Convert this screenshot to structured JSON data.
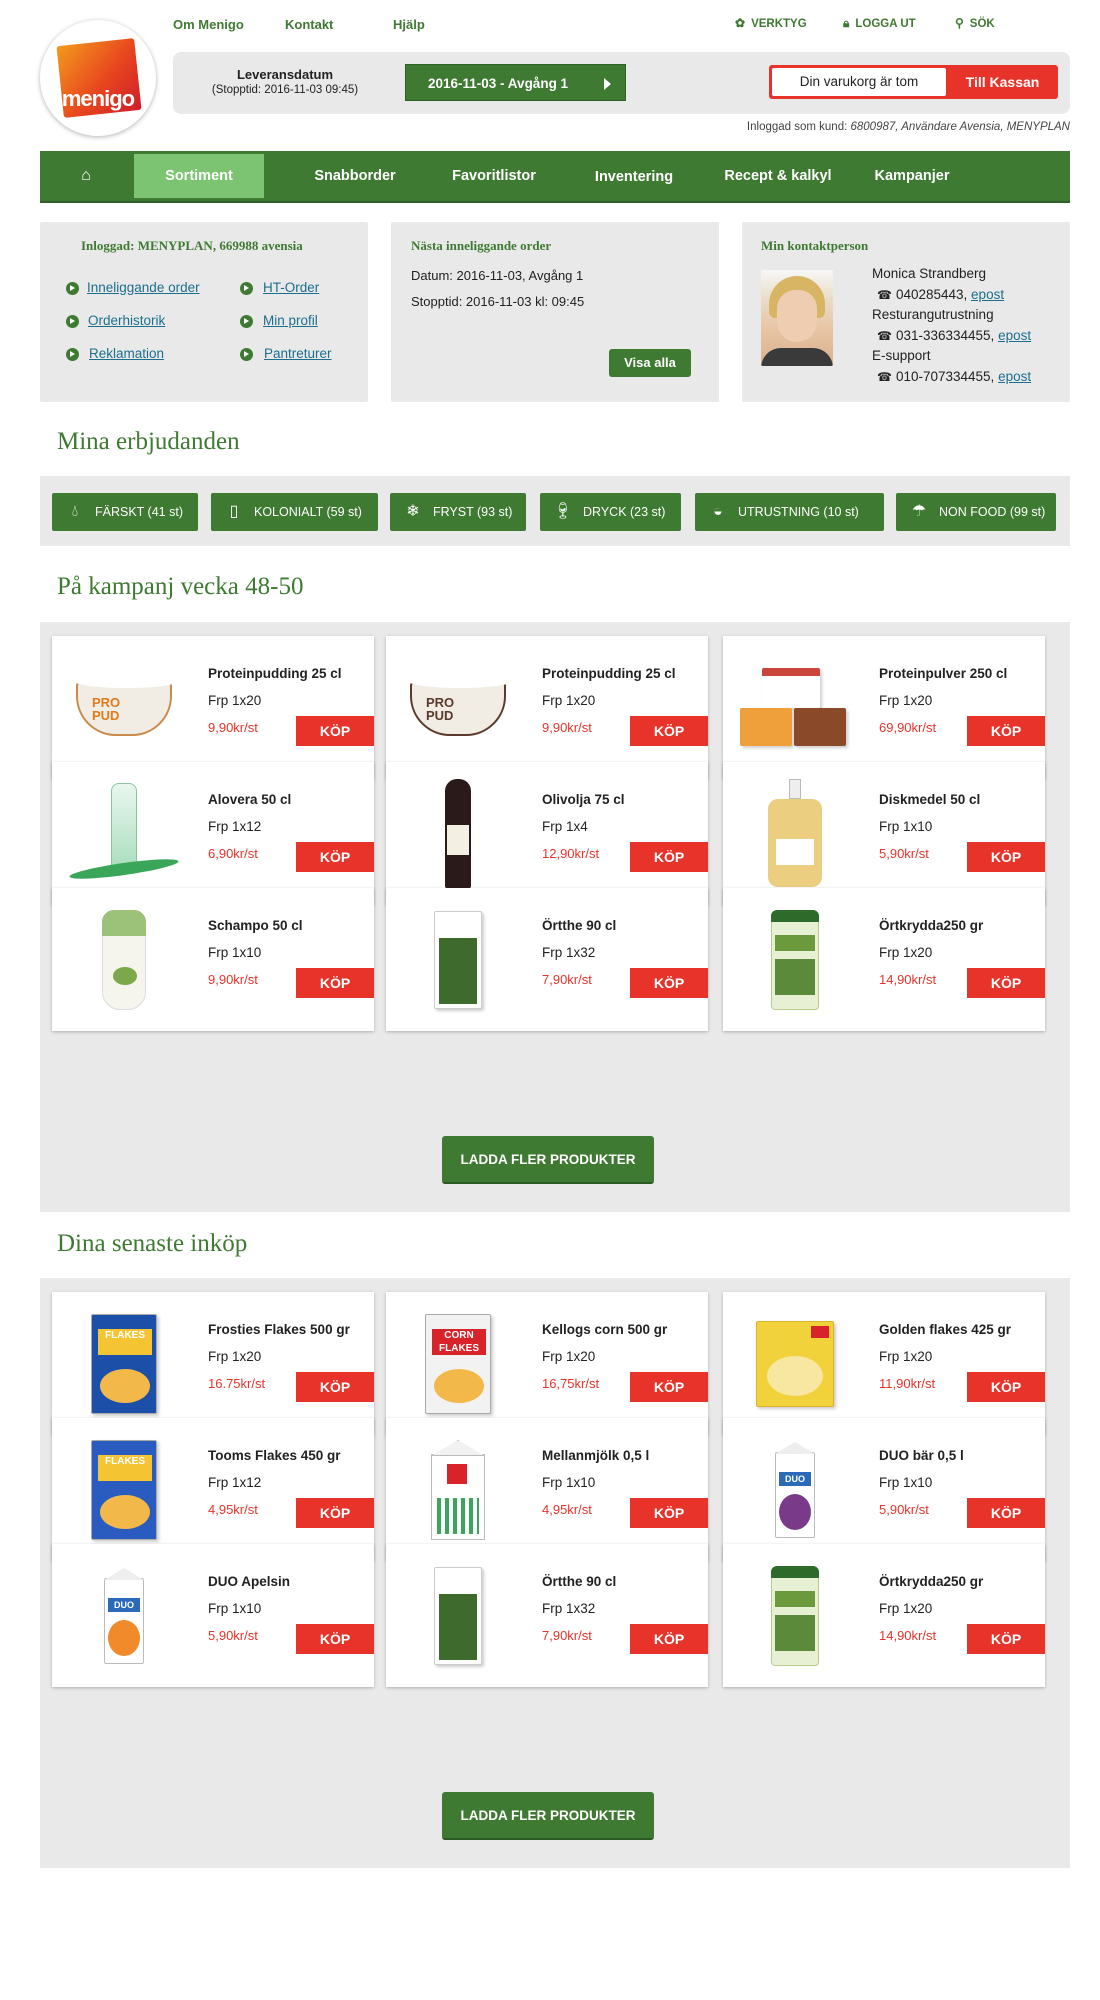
{
  "brand": {
    "logo_text": "menigo"
  },
  "top_links": [
    "Om Menigo",
    "Kontakt",
    "Hjälp"
  ],
  "tools": [
    {
      "label": "VERKTYG",
      "icon": "gear-icon"
    },
    {
      "label": "LOGGA UT",
      "icon": "lock-icon"
    },
    {
      "label": "SÖK",
      "icon": "search-icon"
    }
  ],
  "delivery": {
    "label": "Leveransdatum",
    "stop": "(Stopptid: 2016-11-03 09:45)",
    "selected": "2016-11-03 - Avgång 1"
  },
  "cart": {
    "status": "Din varukorg är tom",
    "checkout": "Till Kassan"
  },
  "logged_in": {
    "prefix": "Inloggad som kund: ",
    "detail": "6800987, Användare Avensia, MENYPLAN"
  },
  "nav": [
    {
      "label": "",
      "icon": "home-icon"
    },
    {
      "label": "Sortiment",
      "active": true
    },
    {
      "label": "Snabborder"
    },
    {
      "label": "Favoritlistor"
    },
    {
      "label": "Inventering"
    },
    {
      "label": "Recept & kalkyl"
    },
    {
      "label": "Kampanjer"
    }
  ],
  "account_box": {
    "title": "Inloggad: MENYPLAN, 669988 avensia",
    "links": [
      "Inneliggande order",
      "HT-Order",
      "Orderhistorik",
      "Min profil",
      "Reklamation",
      "Pantreturer"
    ]
  },
  "order_box": {
    "title": "Nästa inneliggande order",
    "date": "Datum: 2016-11-03, Avgång 1",
    "stop": "Stopptid: 2016-11-03 kl: 09:45",
    "button": "Visa alla"
  },
  "contact_box": {
    "title": "Min kontaktperson",
    "name": "Monica Strandberg",
    "phone1": "040285443,",
    "role2": "Resturangutrustning",
    "phone2": "031-336334455,",
    "role3": "E-support",
    "phone3": "010-707334455,",
    "email": "epost"
  },
  "offers": {
    "heading": "Mina erbjudanden",
    "categories": [
      {
        "label": "FÄRSKT (41 st)",
        "icon": "droplet-icon"
      },
      {
        "label": "KOLONIALT (59 st)",
        "icon": "package-icon"
      },
      {
        "label": "FRYST (93 st)",
        "icon": "snowflake-icon"
      },
      {
        "label": "DRYCK (23 st)",
        "icon": "wine-glass-icon"
      },
      {
        "label": "UTRUSTNING (10 st)",
        "icon": "pan-icon"
      },
      {
        "label": "NON FOOD (99 st)",
        "icon": "umbrella-icon"
      }
    ]
  },
  "campaign": {
    "heading": "På kampanj vecka 48-50",
    "load_more": "LADDA FLER PRODUKTER",
    "buy": "KÖP",
    "products": [
      {
        "name": "Proteinpudding 25 cl",
        "pack": "Frp 1x20",
        "price": "9,90kr/st",
        "image": "protein-pudding-caramel",
        "color": "#c98a4b"
      },
      {
        "name": "Proteinpudding 25 cl",
        "pack": "Frp 1x20",
        "price": "9,90kr/st",
        "image": "protein-pudding-chocolate",
        "color": "#5a3a2a"
      },
      {
        "name": "Proteinpulver 250 cl",
        "pack": "Frp 1x20",
        "price": "69,90kr/st",
        "image": "protein-powder-boxes",
        "color": "#c9463c"
      },
      {
        "name": "Alovera 50 cl",
        "pack": "Frp 1x12",
        "price": "6,90kr/st",
        "image": "aloe-vera-bottle",
        "color": "#3aa65a"
      },
      {
        "name": "Olivolja 75 cl",
        "pack": "Frp 1x4",
        "price": "12,90kr/st",
        "image": "wine-bottle",
        "color": "#2a1a1a"
      },
      {
        "name": "Diskmedel 50 cl",
        "pack": "Frp 1x10",
        "price": "5,90kr/st",
        "image": "pump-bottle",
        "color": "#e8c56a"
      },
      {
        "name": "Schampo 50 cl",
        "pack": "Frp 1x10",
        "price": "9,90kr/st",
        "image": "shampoo-bottle",
        "color": "#9cc27a"
      },
      {
        "name": "Örtthe 90 cl",
        "pack": "Frp 1x32",
        "price": "7,90kr/st",
        "image": "herbal-tea-box",
        "color": "#3e6a2e"
      },
      {
        "name": "Örtkrydda250 gr",
        "pack": "Frp 1x20",
        "price": "14,90kr/st",
        "image": "herbamare-jar",
        "color": "#6a9a3c"
      }
    ]
  },
  "recent": {
    "heading": "Dina senaste inköp",
    "load_more": "LADDA FLER PRODUKTER",
    "buy": "KÖP",
    "products": [
      {
        "name": "Frosties Flakes 500 gr",
        "pack": "Frp 1x20",
        "price": "16.75kr/st",
        "image": "frosties-box",
        "color": "#1c4fa8"
      },
      {
        "name": "Kellogs corn 500 gr",
        "pack": "Frp 1x20",
        "price": "16,75kr/st",
        "image": "cornflakes-box",
        "color": "#f2f2f2"
      },
      {
        "name": "Golden flakes 425 gr",
        "pack": "Frp 1x20",
        "price": "11,90kr/st",
        "image": "golden-flakes-box",
        "color": "#f2d23a"
      },
      {
        "name": "Tooms Flakes 450 gr",
        "pack": "Frp 1x12",
        "price": "4,95kr/st",
        "image": "tooms-flakes-box",
        "color": "#2a5cbf"
      },
      {
        "name": "Mellanmjölk 0,5 l",
        "pack": "Frp 1x10",
        "price": "4,95kr/st",
        "image": "milk-carton",
        "color": "#3aa65a"
      },
      {
        "name": "DUO bär 0,5 l",
        "pack": "Frp 1x10",
        "price": "5,90kr/st",
        "image": "berry-yogurt-carton",
        "color": "#7a3a8a"
      },
      {
        "name": "DUO Apelsin",
        "pack": "Frp 1x10",
        "price": "5,90kr/st",
        "image": "orange-yogurt-carton",
        "color": "#f08a2a"
      },
      {
        "name": "Örtthe 90 cl",
        "pack": "Frp 1x32",
        "price": "7,90kr/st",
        "image": "herbal-tea-box",
        "color": "#3e6a2e"
      },
      {
        "name": "Örtkrydda250 gr",
        "pack": "Frp 1x20",
        "price": "14,90kr/st",
        "image": "herbamare-jar",
        "color": "#6a9a3c"
      }
    ]
  }
}
